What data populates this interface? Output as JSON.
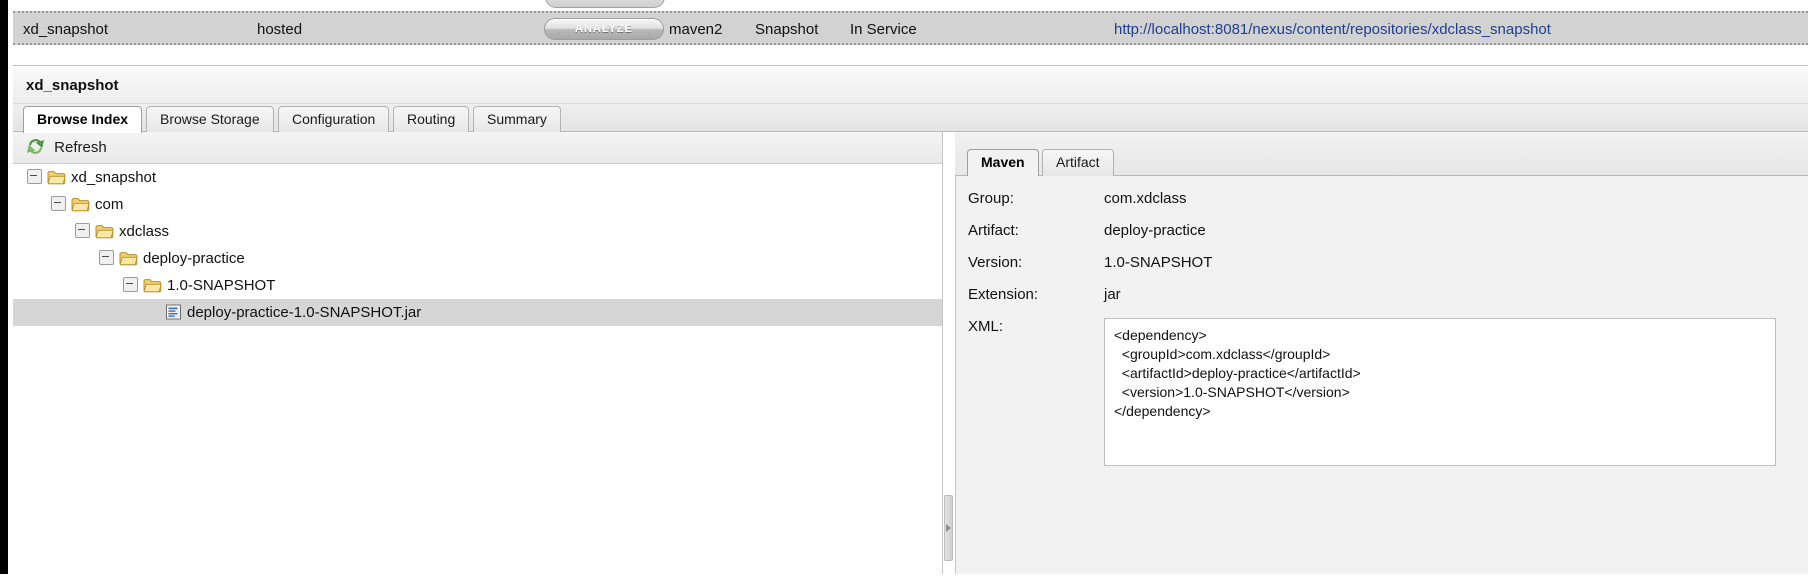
{
  "repository_row": {
    "name": "xd_snapshot",
    "type": "hosted",
    "analyze_label": "ANALYZE",
    "format": "maven2",
    "policy": "Snapshot",
    "status": "In Service",
    "url": "http://localhost:8081/nexus/content/repositories/xdclass_snapshot",
    "row_background": "#d2d2d2",
    "url_color": "#1f3f8f"
  },
  "panel": {
    "title": "xd_snapshot",
    "tabs": [
      {
        "label": "Browse Index",
        "active": true
      },
      {
        "label": "Browse Storage",
        "active": false
      },
      {
        "label": "Configuration",
        "active": false
      },
      {
        "label": "Routing",
        "active": false
      },
      {
        "label": "Summary",
        "active": false
      }
    ]
  },
  "tree_panel": {
    "refresh_label": "Refresh",
    "refresh_icon": "refresh-icon",
    "nodes": [
      {
        "label": "xd_snapshot",
        "depth": 0,
        "icon": "folder-icon",
        "expanded": true,
        "selected": false
      },
      {
        "label": "com",
        "depth": 1,
        "icon": "folder-icon",
        "expanded": true,
        "selected": false
      },
      {
        "label": "xdclass",
        "depth": 2,
        "icon": "folder-icon",
        "expanded": true,
        "selected": false
      },
      {
        "label": "deploy-practice",
        "depth": 3,
        "icon": "folder-icon",
        "expanded": true,
        "selected": false
      },
      {
        "label": "1.0-SNAPSHOT",
        "depth": 4,
        "icon": "folder-icon",
        "expanded": true,
        "selected": false
      },
      {
        "label": "deploy-practice-1.0-SNAPSHOT.jar",
        "depth": 5,
        "icon": "jar-file-icon",
        "expanded": false,
        "selected": true
      }
    ]
  },
  "detail_panel": {
    "tabs": [
      {
        "label": "Maven",
        "active": true
      },
      {
        "label": "Artifact",
        "active": false
      }
    ],
    "fields": [
      {
        "label": "Group:",
        "value": "com.xdclass"
      },
      {
        "label": "Artifact:",
        "value": "deploy-practice"
      },
      {
        "label": "Version:",
        "value": "1.0-SNAPSHOT"
      },
      {
        "label": "Extension:",
        "value": "jar"
      }
    ],
    "xml_label": "XML:",
    "xml_value": "<dependency>\n  <groupId>com.xdclass</groupId>\n  <artifactId>deploy-practice</artifactId>\n  <version>1.0-SNAPSHOT</version>\n</dependency>"
  },
  "splitter": {
    "collapse_icon": "collapse-arrow-icon"
  }
}
